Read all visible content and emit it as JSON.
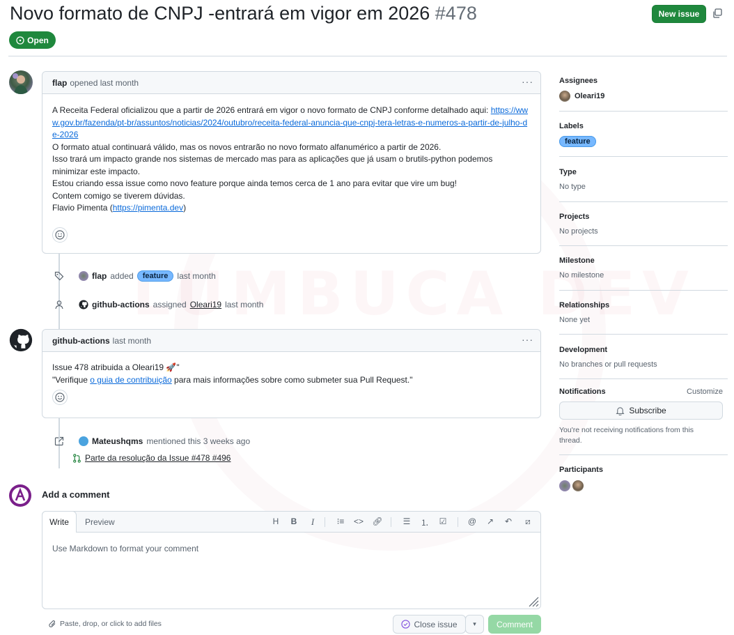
{
  "issue": {
    "title": "Novo formato de CNPJ -entrará em vigor em 2026",
    "number": "#478",
    "state": "Open",
    "new_issue_label": "New issue"
  },
  "comments": [
    {
      "author": "flap",
      "meta": "opened last month",
      "body_lines": {
        "l1_text": "A Receita Federal oficializou que a partir de 2026 entrará em vigor o novo formato de CNPJ conforme detalhado aqui: ",
        "l1_link": "https://www.gov.br/fazenda/pt-br/assuntos/noticias/2024/outubro/receita-federal-anuncia-que-cnpj-tera-letras-e-numeros-a-partir-de-julho-de-2026",
        "l2": "O formato atual continuará válido, mas os novos entrarão no novo formato alfanumérico a partir de 2026.",
        "l3": "Isso trará um impacto grande nos sistemas de mercado mas para as aplicações que já usam o brutils-python podemos minimizar este impacto.",
        "l4": "Estou criando essa issue como novo feature porque ainda temos cerca de 1 ano para evitar que vire um bug!",
        "l5": "Contem comigo se tiverem dúvidas.",
        "l6_prefix": "Flavio Pimenta (",
        "l6_link": "https://pimenta.dev",
        "l6_suffix": ")"
      }
    },
    {
      "author": "github-actions",
      "meta": "last month",
      "body_lines": {
        "l1": "Issue 478 atribuida a Oleari19 🚀\"",
        "l2_prefix": "\"Verifique ",
        "l2_link": "o guia de contribuição",
        "l2_suffix": " para mais informações sobre como submeter sua Pull Request.\""
      }
    }
  ],
  "events": {
    "label_event": {
      "actor": "flap",
      "action": "added",
      "label": "feature",
      "time": "last month"
    },
    "assign_event": {
      "actor": "github-actions",
      "action": "assigned",
      "target": "Oleari19",
      "time": "last month"
    },
    "mention_event": {
      "actor": "Mateushqms",
      "action": "mentioned this 3 weeks ago",
      "ref_title": "Parte da resolução da Issue #478 #496"
    }
  },
  "composer": {
    "heading": "Add a comment",
    "tab_write": "Write",
    "tab_preview": "Preview",
    "placeholder": "Use Markdown to format your comment",
    "attach_hint": "Paste, drop, or click to add files",
    "close_issue_label": "Close issue",
    "comment_label": "Comment",
    "toolbar": [
      "H",
      "B",
      "I",
      "quote",
      "code",
      "link",
      "ul",
      "ol",
      "tasks",
      "mention",
      "reference",
      "undo",
      "fullscreen"
    ]
  },
  "sidebar": {
    "assignees": {
      "title": "Assignees",
      "value": "Oleari19"
    },
    "labels": {
      "title": "Labels",
      "value": "feature"
    },
    "type": {
      "title": "Type",
      "value": "No type"
    },
    "projects": {
      "title": "Projects",
      "value": "No projects"
    },
    "milestone": {
      "title": "Milestone",
      "value": "No milestone"
    },
    "relationships": {
      "title": "Relationships",
      "value": "None yet"
    },
    "development": {
      "title": "Development",
      "value": "No branches or pull requests"
    },
    "notifications": {
      "title": "Notifications",
      "customize": "Customize",
      "subscribe": "Subscribe",
      "note": "You're not receiving notifications from this thread."
    },
    "participants": {
      "title": "Participants"
    }
  },
  "watermark": "LUMBUCA DEV",
  "colors": {
    "green": "#1f883d",
    "label": "#77b8ff",
    "link": "#0969da",
    "border": "#d1d9e0"
  }
}
